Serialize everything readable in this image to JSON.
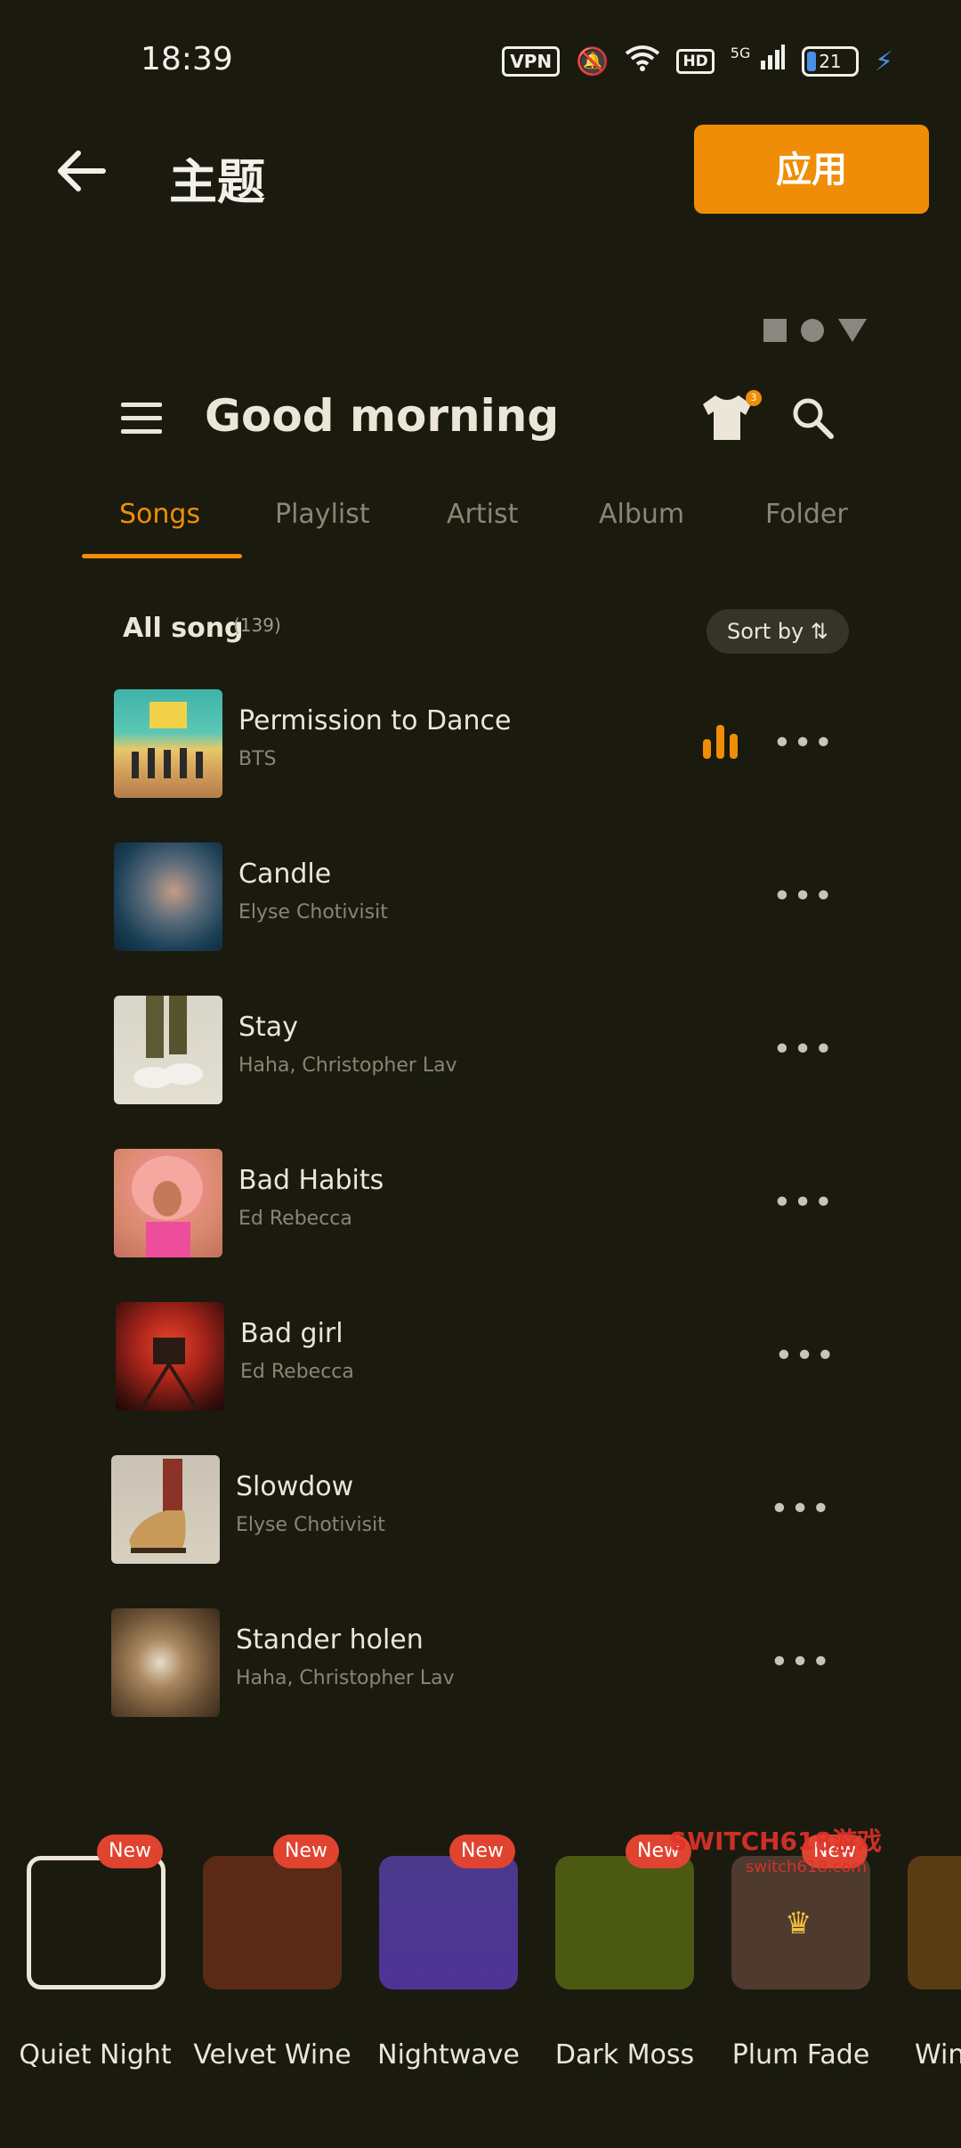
{
  "status_bar": {
    "time": "18:39",
    "vpn": "VPN",
    "hd": "HD",
    "network": "5G",
    "battery": "21"
  },
  "header": {
    "title": "主题",
    "apply_label": "应用"
  },
  "preview": {
    "greeting": "Good morning",
    "shirt_badge": "3",
    "tabs": [
      "Songs",
      "Playlist",
      "Artist",
      "Album",
      "Folder"
    ],
    "active_tab": "Songs",
    "list_title": "All song",
    "list_count": "(139)",
    "sort_label": "Sort by ⇅",
    "songs": [
      {
        "title": "Permission to Dance",
        "artist": "BTS",
        "playing": true
      },
      {
        "title": "Candle",
        "artist": "Elyse Chotivisit"
      },
      {
        "title": "Stay",
        "artist": "Haha, Christopher Lav"
      },
      {
        "title": "Bad Habits",
        "artist": "Ed Rebecca"
      },
      {
        "title": "Bad girl",
        "artist": "Ed Rebecca"
      },
      {
        "title": "Slowdow",
        "artist": "Elyse Chotivisit"
      },
      {
        "title": "Stander holen",
        "artist": "Haha, Christopher Lav"
      }
    ],
    "more_label": "•••"
  },
  "themes": [
    {
      "name": "Quiet Night",
      "badge": "New",
      "color": "#1a1a0f",
      "selected": true
    },
    {
      "name": "Velvet Wine",
      "badge": "New",
      "color": "#5a2a17"
    },
    {
      "name": "Nightwave",
      "badge": "New",
      "color": "#4b3590"
    },
    {
      "name": "Dark Moss",
      "badge": "New",
      "color": "#4b5912"
    },
    {
      "name": "Plum Fade",
      "badge": "New",
      "color": "#4e3a2e",
      "premium": true
    },
    {
      "name": "Win",
      "badge": "",
      "color": "#5a3c14"
    }
  ],
  "watermark": {
    "line1": "SWITCH618游戏",
    "line2": "switch618.com"
  },
  "colors": {
    "accent": "#ef8e06",
    "background": "#1a1a0f",
    "badge": "#e0432f"
  }
}
